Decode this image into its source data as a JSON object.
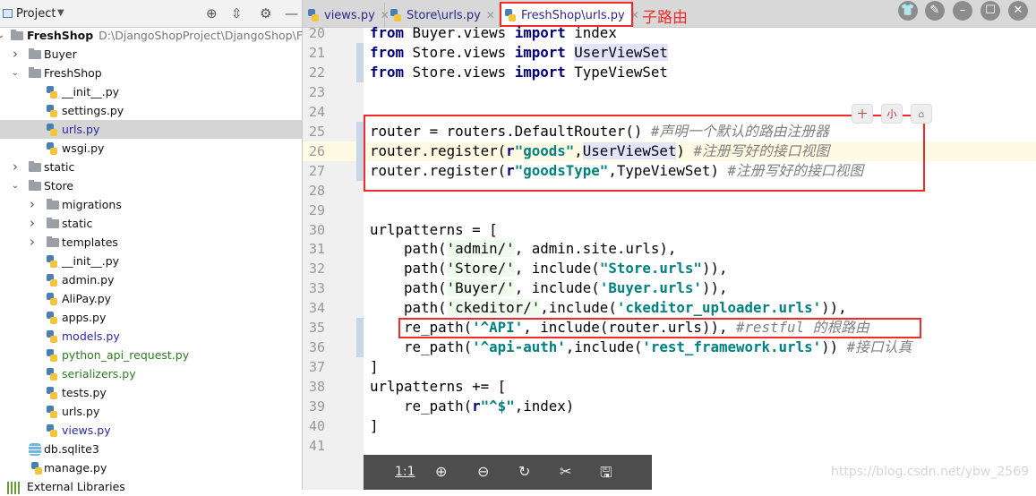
{
  "sidebar": {
    "title": "Project",
    "root": {
      "name": "FreshShop",
      "path": "D:\\DjangoShopProject\\DjangoShop\\FreshShop"
    },
    "items": [
      {
        "label": "Buyer",
        "type": "folder",
        "level": 1,
        "state": "collapsed"
      },
      {
        "label": "FreshShop",
        "type": "folder",
        "level": 1,
        "state": "expanded"
      },
      {
        "label": "__init__.py",
        "type": "py",
        "level": 2
      },
      {
        "label": "settings.py",
        "type": "py",
        "level": 2
      },
      {
        "label": "urls.py",
        "type": "py",
        "level": 2,
        "selected": true,
        "color": "#2a2aa0"
      },
      {
        "label": "wsgi.py",
        "type": "py",
        "level": 2
      },
      {
        "label": "static",
        "type": "folder",
        "level": 1,
        "state": "collapsed"
      },
      {
        "label": "Store",
        "type": "folder",
        "level": 1,
        "state": "expanded"
      },
      {
        "label": "migrations",
        "type": "folder",
        "level": 2,
        "state": "collapsed"
      },
      {
        "label": "static",
        "type": "folder",
        "level": 2,
        "state": "collapsed"
      },
      {
        "label": "templates",
        "type": "folder",
        "level": 2,
        "state": "collapsed"
      },
      {
        "label": "__init__.py",
        "type": "py",
        "level": 2
      },
      {
        "label": "admin.py",
        "type": "py",
        "level": 2
      },
      {
        "label": "AliPay.py",
        "type": "py",
        "level": 2
      },
      {
        "label": "apps.py",
        "type": "py",
        "level": 2
      },
      {
        "label": "models.py",
        "type": "py",
        "level": 2,
        "color": "#2a2aa0"
      },
      {
        "label": "python_api_request.py",
        "type": "py",
        "level": 2,
        "color": "#2d7a1f"
      },
      {
        "label": "serializers.py",
        "type": "py",
        "level": 2,
        "color": "#2d7a1f"
      },
      {
        "label": "tests.py",
        "type": "py",
        "level": 2
      },
      {
        "label": "urls.py",
        "type": "py",
        "level": 2
      },
      {
        "label": "views.py",
        "type": "py",
        "level": 2,
        "color": "#2a2aa0"
      },
      {
        "label": "db.sqlite3",
        "type": "db",
        "level": 1
      },
      {
        "label": "manage.py",
        "type": "py",
        "level": 1
      },
      {
        "label": "External Libraries",
        "type": "lib",
        "level": 0
      }
    ]
  },
  "tabs": [
    {
      "label": "views.py"
    },
    {
      "label": "Store\\urls.py"
    },
    {
      "label": "FreshShop\\urls.py",
      "active": true
    }
  ],
  "annotation": {
    "label": "子路由",
    "color": "#ee2a2a"
  },
  "editor": {
    "current_line": 26,
    "lines": [
      {
        "num": "20",
        "tokens": [
          [
            "from",
            "kw"
          ],
          " Buyer.views ",
          [
            "import",
            "kw"
          ],
          " index"
        ]
      },
      {
        "num": "21",
        "tokens": [
          [
            "from",
            "kw"
          ],
          " Store.views ",
          [
            "import",
            "kw"
          ],
          " ",
          [
            "UserViewSet",
            "hl"
          ]
        ]
      },
      {
        "num": "22",
        "tokens": [
          [
            "from",
            "kw"
          ],
          " Store.views ",
          [
            "import",
            "kw"
          ],
          " TypeViewSet"
        ]
      },
      {
        "num": "23",
        "tokens": []
      },
      {
        "num": "24",
        "tokens": []
      },
      {
        "num": "25",
        "tokens": [
          "router = routers.DefaultRouter() ",
          [
            "#声明一个默认的路由注册器",
            "cm"
          ]
        ]
      },
      {
        "num": "26",
        "tokens": [
          "router.register(",
          [
            "r",
            "kw"
          ],
          [
            "\"goods\"",
            "str"
          ],
          ",",
          [
            "UserViewSet",
            "hl"
          ],
          ") ",
          [
            "#注册写好的接口视图",
            "cm"
          ]
        ]
      },
      {
        "num": "27",
        "tokens": [
          "router.register(",
          [
            "r",
            "kw"
          ],
          [
            "\"goodsType\"",
            "str"
          ],
          ",TypeViewSet) ",
          [
            "#注册写好的接口视图",
            "cm"
          ]
        ]
      },
      {
        "num": "28",
        "tokens": []
      },
      {
        "num": "29",
        "tokens": []
      },
      {
        "num": "30",
        "tokens": [
          "urlpatterns = ["
        ]
      },
      {
        "num": "31",
        "tokens": [
          "    path(",
          [
            "'admin/'",
            "sq"
          ],
          ", admin.site.urls),"
        ]
      },
      {
        "num": "32",
        "tokens": [
          "    path(",
          [
            "'Store/'",
            "sq"
          ],
          ", include(",
          [
            "\"Store.urls\"",
            "str"
          ],
          ")),"
        ]
      },
      {
        "num": "33",
        "tokens": [
          "    path(",
          [
            "'Buyer/'",
            "sq"
          ],
          ", include(",
          [
            "'Buyer.urls'",
            "str"
          ],
          ")),"
        ]
      },
      {
        "num": "34",
        "tokens": [
          "    path(",
          [
            "'ckeditor/'",
            "sq"
          ],
          ",include(",
          [
            "'ckeditor_uploader.urls'",
            "str"
          ],
          ")),"
        ]
      },
      {
        "num": "35",
        "tokens": [
          "    re_path(",
          [
            "'^API'",
            "str"
          ],
          ", include(router.urls)), ",
          [
            "#restful 的根路由",
            "cm"
          ]
        ]
      },
      {
        "num": "36",
        "tokens": [
          "    re_path(",
          [
            "'^api-auth'",
            "str"
          ],
          ",include(",
          [
            "'rest_framework.urls'",
            "str"
          ],
          ")) ",
          [
            "#接口认真",
            "cm"
          ]
        ]
      },
      {
        "num": "37",
        "tokens": [
          "]"
        ]
      },
      {
        "num": "38",
        "tokens": [
          "urlpatterns += ["
        ]
      },
      {
        "num": "39",
        "tokens": [
          "    re_path(",
          [
            "r",
            "kw"
          ],
          [
            "\"^$\"",
            "str"
          ],
          ",index)"
        ]
      },
      {
        "num": "40",
        "tokens": [
          "]"
        ]
      },
      {
        "num": "41",
        "tokens": []
      }
    ]
  },
  "toolbar": {
    "actual_size": "1:1"
  },
  "watermark": "https://blog.csdn.net/ybw_2569"
}
